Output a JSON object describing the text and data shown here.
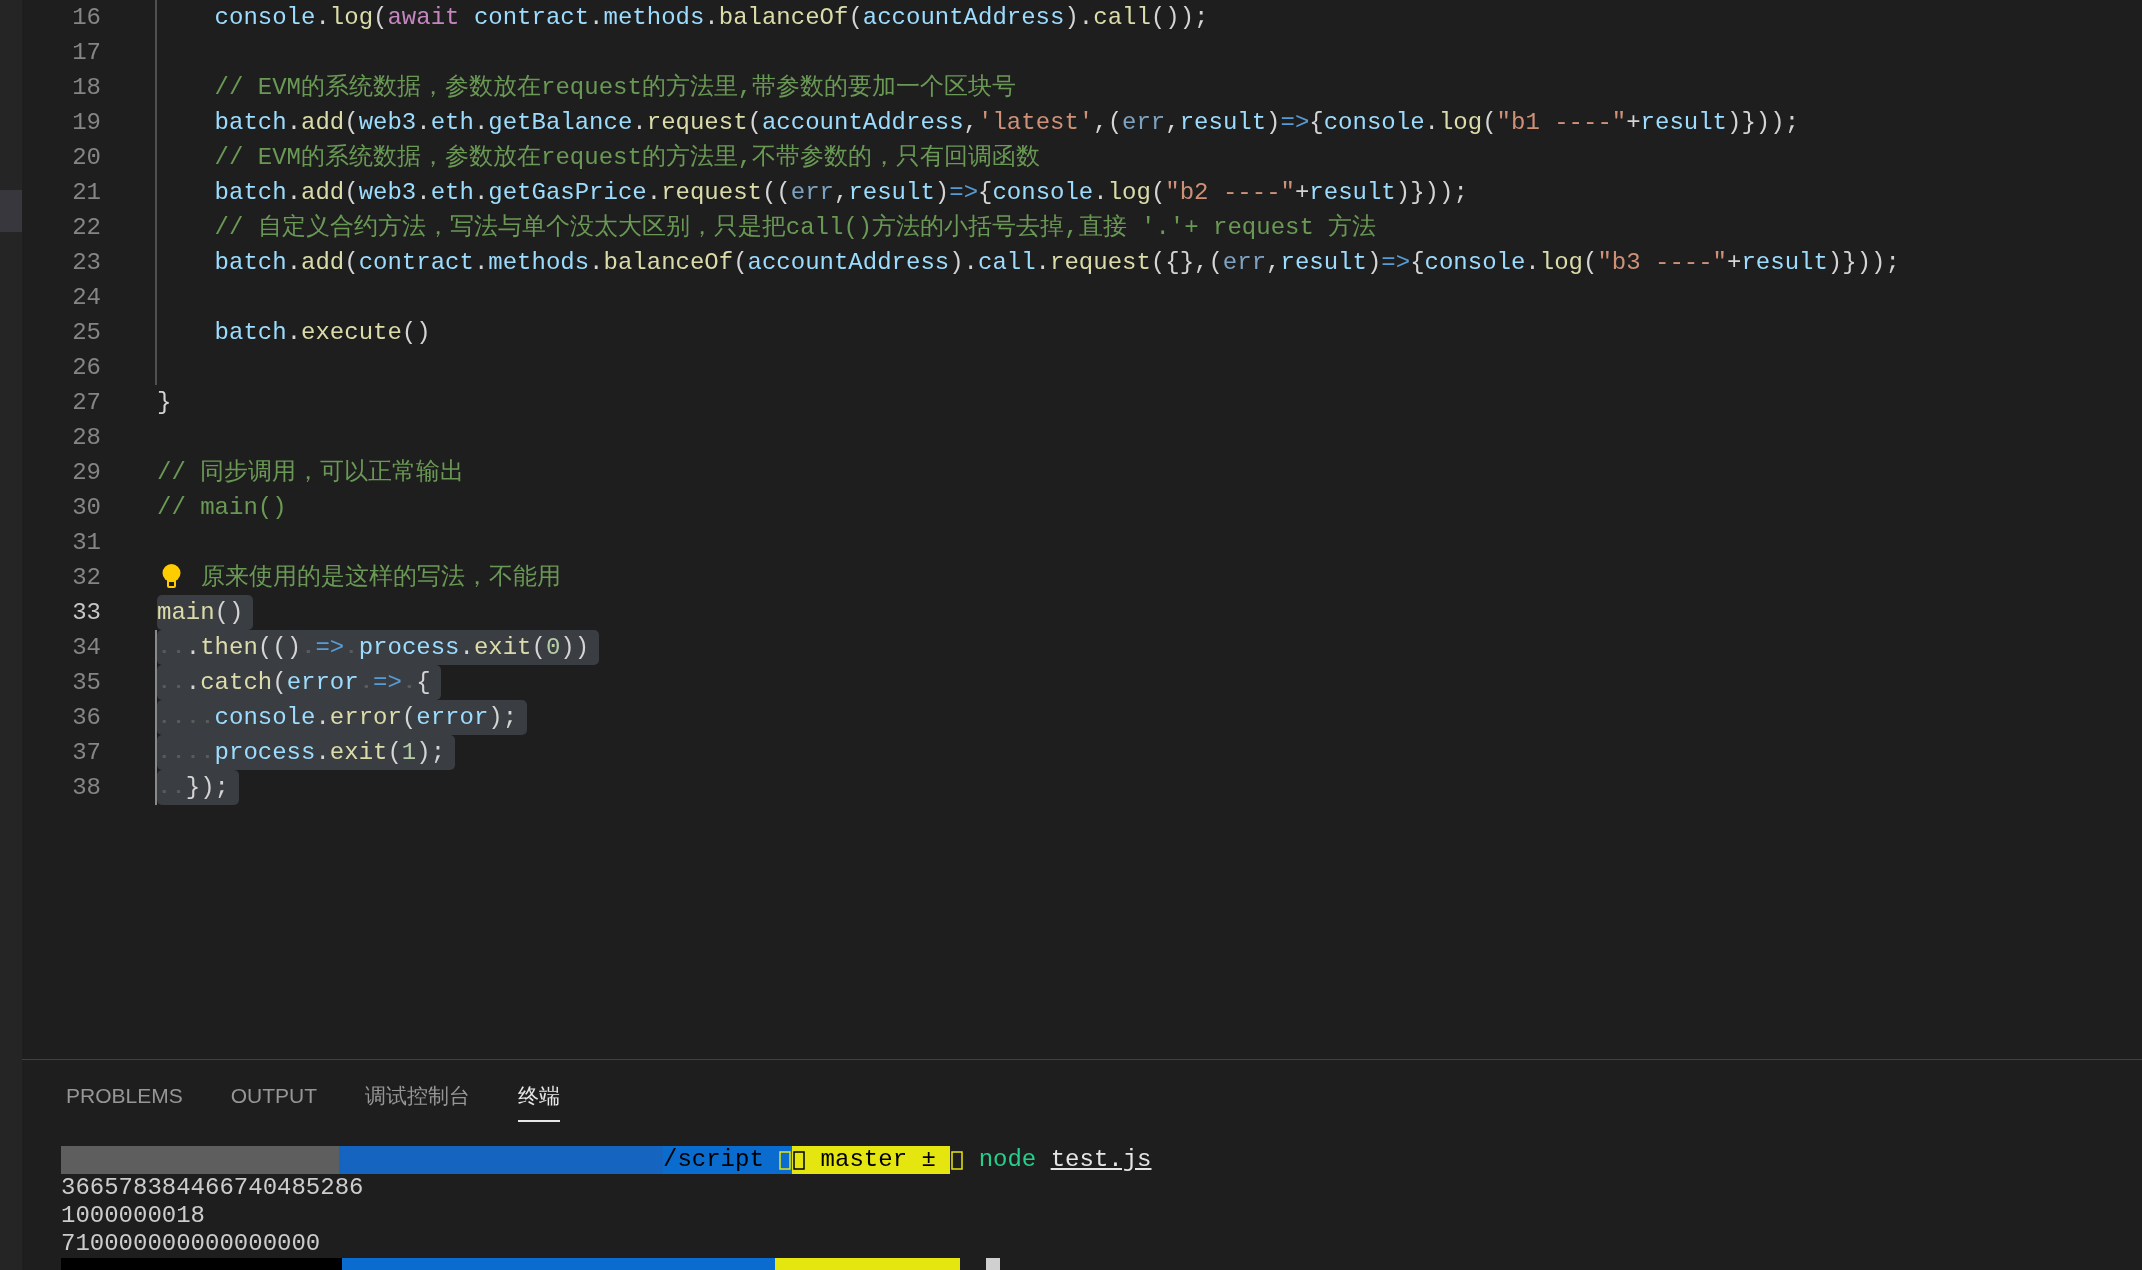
{
  "editor": {
    "lines": [
      {
        "number": "16",
        "current": false,
        "selected": false,
        "indent_guide": true,
        "tokens": [
          {
            "kind": "var",
            "text": "    console"
          },
          {
            "kind": "p",
            "text": "."
          },
          {
            "kind": "fn",
            "text": "log"
          },
          {
            "kind": "p",
            "text": "("
          },
          {
            "kind": "kw",
            "text": "await"
          },
          {
            "kind": "var",
            "text": " contract"
          },
          {
            "kind": "p",
            "text": "."
          },
          {
            "kind": "var",
            "text": "methods"
          },
          {
            "kind": "p",
            "text": "."
          },
          {
            "kind": "fn",
            "text": "balanceOf"
          },
          {
            "kind": "p",
            "text": "("
          },
          {
            "kind": "var",
            "text": "accountAddress"
          },
          {
            "kind": "p",
            "text": ")."
          },
          {
            "kind": "fn",
            "text": "call"
          },
          {
            "kind": "p",
            "text": "());"
          }
        ]
      },
      {
        "number": "17",
        "current": false,
        "selected": false,
        "indent_guide": true
      },
      {
        "number": "18",
        "current": false,
        "selected": false,
        "indent_guide": true,
        "tokens": [
          {
            "kind": "cm",
            "text": "    // EVM的系统数据，参数放在request的方法里,带参数的要加一个区块号"
          }
        ]
      },
      {
        "number": "19",
        "current": false,
        "selected": false,
        "indent_guide": true,
        "tokens": [
          {
            "kind": "var",
            "text": "    batch"
          },
          {
            "kind": "p",
            "text": "."
          },
          {
            "kind": "fn",
            "text": "add"
          },
          {
            "kind": "p",
            "text": "("
          },
          {
            "kind": "var",
            "text": "web3"
          },
          {
            "kind": "p",
            "text": "."
          },
          {
            "kind": "var",
            "text": "eth"
          },
          {
            "kind": "p",
            "text": "."
          },
          {
            "kind": "var",
            "text": "getBalance"
          },
          {
            "kind": "p",
            "text": "."
          },
          {
            "kind": "fn",
            "text": "request"
          },
          {
            "kind": "p",
            "text": "("
          },
          {
            "kind": "var",
            "text": "accountAddress"
          },
          {
            "kind": "p",
            "text": ","
          },
          {
            "kind": "str",
            "text": "'latest'"
          },
          {
            "kind": "p",
            "text": ",("
          },
          {
            "kind": "prm",
            "text": "err"
          },
          {
            "kind": "p",
            "text": ","
          },
          {
            "kind": "var",
            "text": "result"
          },
          {
            "kind": "p",
            "text": ")"
          },
          {
            "kind": "op",
            "text": "=>"
          },
          {
            "kind": "p",
            "text": "{"
          },
          {
            "kind": "var",
            "text": "console"
          },
          {
            "kind": "p",
            "text": "."
          },
          {
            "kind": "fn",
            "text": "log"
          },
          {
            "kind": "p",
            "text": "("
          },
          {
            "kind": "str",
            "text": "\"b1 ----\""
          },
          {
            "kind": "p",
            "text": "+"
          },
          {
            "kind": "var",
            "text": "result"
          },
          {
            "kind": "p",
            "text": ")}));"
          }
        ]
      },
      {
        "number": "20",
        "current": false,
        "selected": false,
        "indent_guide": true,
        "tokens": [
          {
            "kind": "cm",
            "text": "    // EVM的系统数据，参数放在request的方法里,不带参数的，只有回调函数"
          }
        ]
      },
      {
        "number": "21",
        "current": false,
        "selected": false,
        "indent_guide": true,
        "tokens": [
          {
            "kind": "var",
            "text": "    batch"
          },
          {
            "kind": "p",
            "text": "."
          },
          {
            "kind": "fn",
            "text": "add"
          },
          {
            "kind": "p",
            "text": "("
          },
          {
            "kind": "var",
            "text": "web3"
          },
          {
            "kind": "p",
            "text": "."
          },
          {
            "kind": "var",
            "text": "eth"
          },
          {
            "kind": "p",
            "text": "."
          },
          {
            "kind": "var",
            "text": "getGasPrice"
          },
          {
            "kind": "p",
            "text": "."
          },
          {
            "kind": "fn",
            "text": "request"
          },
          {
            "kind": "p",
            "text": "(("
          },
          {
            "kind": "prm",
            "text": "err"
          },
          {
            "kind": "p",
            "text": ","
          },
          {
            "kind": "var",
            "text": "result"
          },
          {
            "kind": "p",
            "text": ")"
          },
          {
            "kind": "op",
            "text": "=>"
          },
          {
            "kind": "p",
            "text": "{"
          },
          {
            "kind": "var",
            "text": "console"
          },
          {
            "kind": "p",
            "text": "."
          },
          {
            "kind": "fn",
            "text": "log"
          },
          {
            "kind": "p",
            "text": "("
          },
          {
            "kind": "str",
            "text": "\"b2 ----\""
          },
          {
            "kind": "p",
            "text": "+"
          },
          {
            "kind": "var",
            "text": "result"
          },
          {
            "kind": "p",
            "text": ")}));"
          }
        ]
      },
      {
        "number": "22",
        "current": false,
        "selected": false,
        "indent_guide": true,
        "tokens": [
          {
            "kind": "cm",
            "text": "    // 自定义合约方法，写法与单个没太大区别，只是把call()方法的小括号去掉,直接 '.'+ request 方法"
          }
        ]
      },
      {
        "number": "23",
        "current": false,
        "selected": false,
        "indent_guide": true,
        "tokens": [
          {
            "kind": "var",
            "text": "    batch"
          },
          {
            "kind": "p",
            "text": "."
          },
          {
            "kind": "fn",
            "text": "add"
          },
          {
            "kind": "p",
            "text": "("
          },
          {
            "kind": "var",
            "text": "contract"
          },
          {
            "kind": "p",
            "text": "."
          },
          {
            "kind": "var",
            "text": "methods"
          },
          {
            "kind": "p",
            "text": "."
          },
          {
            "kind": "fn",
            "text": "balanceOf"
          },
          {
            "kind": "p",
            "text": "("
          },
          {
            "kind": "var",
            "text": "accountAddress"
          },
          {
            "kind": "p",
            "text": ")."
          },
          {
            "kind": "var",
            "text": "call"
          },
          {
            "kind": "p",
            "text": "."
          },
          {
            "kind": "fn",
            "text": "request"
          },
          {
            "kind": "p",
            "text": "({},("
          },
          {
            "kind": "prm",
            "text": "err"
          },
          {
            "kind": "p",
            "text": ","
          },
          {
            "kind": "var",
            "text": "result"
          },
          {
            "kind": "p",
            "text": ")"
          },
          {
            "kind": "op",
            "text": "=>"
          },
          {
            "kind": "p",
            "text": "{"
          },
          {
            "kind": "var",
            "text": "console"
          },
          {
            "kind": "p",
            "text": "."
          },
          {
            "kind": "fn",
            "text": "log"
          },
          {
            "kind": "p",
            "text": "("
          },
          {
            "kind": "str",
            "text": "\"b3 ----\""
          },
          {
            "kind": "p",
            "text": "+"
          },
          {
            "kind": "var",
            "text": "result"
          },
          {
            "kind": "p",
            "text": ")}));"
          }
        ]
      },
      {
        "number": "24",
        "current": false,
        "selected": false,
        "indent_guide": true
      },
      {
        "number": "25",
        "current": false,
        "selected": false,
        "indent_guide": true,
        "tokens": [
          {
            "kind": "var",
            "text": "    batch"
          },
          {
            "kind": "p",
            "text": "."
          },
          {
            "kind": "fn",
            "text": "execute"
          },
          {
            "kind": "p",
            "text": "()"
          }
        ]
      },
      {
        "number": "26",
        "current": false,
        "selected": false,
        "indent_guide": true
      },
      {
        "number": "27",
        "current": false,
        "selected": false,
        "indent_guide": false,
        "tokens": [
          {
            "kind": "p",
            "text": "}"
          }
        ]
      },
      {
        "number": "28",
        "current": false,
        "selected": false,
        "indent_guide": false
      },
      {
        "number": "29",
        "current": false,
        "selected": false,
        "indent_guide": false,
        "tokens": [
          {
            "kind": "cm",
            "text": "// 同步调用，可以正常输出"
          }
        ]
      },
      {
        "number": "30",
        "current": false,
        "selected": false,
        "indent_guide": false,
        "tokens": [
          {
            "kind": "cm",
            "text": "// main()"
          }
        ]
      },
      {
        "number": "31",
        "current": false,
        "selected": false,
        "indent_guide": false
      },
      {
        "number": "32",
        "current": false,
        "selected": false,
        "indent_guide": false,
        "lightbulb": true,
        "tokens": [
          {
            "kind": "cm",
            "text": "原来使用的是这样的写法，不能用"
          }
        ]
      },
      {
        "number": "33",
        "current": true,
        "selected": true,
        "indent_guide": false,
        "tokens": [
          {
            "kind": "fn",
            "text": "main"
          },
          {
            "kind": "p",
            "text": "()"
          }
        ]
      },
      {
        "number": "34",
        "current": false,
        "selected": true,
        "indent_guide": true,
        "tokens": [
          {
            "kind": "p",
            "text": "  ."
          },
          {
            "kind": "fn",
            "text": "then"
          },
          {
            "kind": "p",
            "text": "(() "
          },
          {
            "kind": "op",
            "text": "=>"
          },
          {
            "kind": "var",
            "text": " process"
          },
          {
            "kind": "p",
            "text": "."
          },
          {
            "kind": "fn",
            "text": "exit"
          },
          {
            "kind": "p",
            "text": "("
          },
          {
            "kind": "num",
            "text": "0"
          },
          {
            "kind": "p",
            "text": "))"
          }
        ]
      },
      {
        "number": "35",
        "current": false,
        "selected": true,
        "indent_guide": true,
        "tokens": [
          {
            "kind": "p",
            "text": "  ."
          },
          {
            "kind": "fn",
            "text": "catch"
          },
          {
            "kind": "p",
            "text": "("
          },
          {
            "kind": "var",
            "text": "error "
          },
          {
            "kind": "op",
            "text": "=>"
          },
          {
            "kind": "p",
            "text": " {"
          }
        ]
      },
      {
        "number": "36",
        "current": false,
        "selected": true,
        "indent_guide": true,
        "tokens": [
          {
            "kind": "var",
            "text": "    console"
          },
          {
            "kind": "p",
            "text": "."
          },
          {
            "kind": "fn",
            "text": "error"
          },
          {
            "kind": "p",
            "text": "("
          },
          {
            "kind": "var",
            "text": "error"
          },
          {
            "kind": "p",
            "text": ");"
          }
        ]
      },
      {
        "number": "37",
        "current": false,
        "selected": true,
        "indent_guide": true,
        "tokens": [
          {
            "kind": "var",
            "text": "    process"
          },
          {
            "kind": "p",
            "text": "."
          },
          {
            "kind": "fn",
            "text": "exit"
          },
          {
            "kind": "p",
            "text": "("
          },
          {
            "kind": "num",
            "text": "1"
          },
          {
            "kind": "p",
            "text": ");"
          }
        ]
      },
      {
        "number": "38",
        "current": false,
        "selected": true,
        "indent_guide": true,
        "tokens": [
          {
            "kind": "p",
            "text": "  });"
          }
        ]
      }
    ]
  },
  "panel": {
    "tabs": [
      {
        "label": "PROBLEMS",
        "selected": false
      },
      {
        "label": "OUTPUT",
        "selected": false
      },
      {
        "label": "调试控制台",
        "selected": false
      },
      {
        "label": "终端",
        "selected": true
      }
    ],
    "terminal": {
      "prompt": [
        {
          "kind": "redacted",
          "color": "#5e5e5e"
        },
        {
          "kind": "redacted",
          "color": "#1565c0"
        },
        {
          "kind": "path",
          "text": "/script "
        },
        {
          "kind": "glyph"
        },
        {
          "kind": "glyph_dark"
        },
        {
          "kind": "branch",
          "text": " master ± "
        },
        {
          "kind": "glyph_end"
        },
        {
          "kind": "command",
          "text": " node "
        },
        {
          "kind": "argument",
          "text": "test.js"
        }
      ],
      "output": [
        "366578384466740485286",
        "1000000018",
        "710000000000000000"
      ],
      "last_line": [
        {
          "kind": "redacted",
          "color": "#000000"
        },
        {
          "kind": "redacted",
          "color": "#0a6ccf"
        },
        {
          "kind": "redacted",
          "color": "#e5e510"
        },
        {
          "kind": "cursor"
        }
      ]
    }
  }
}
